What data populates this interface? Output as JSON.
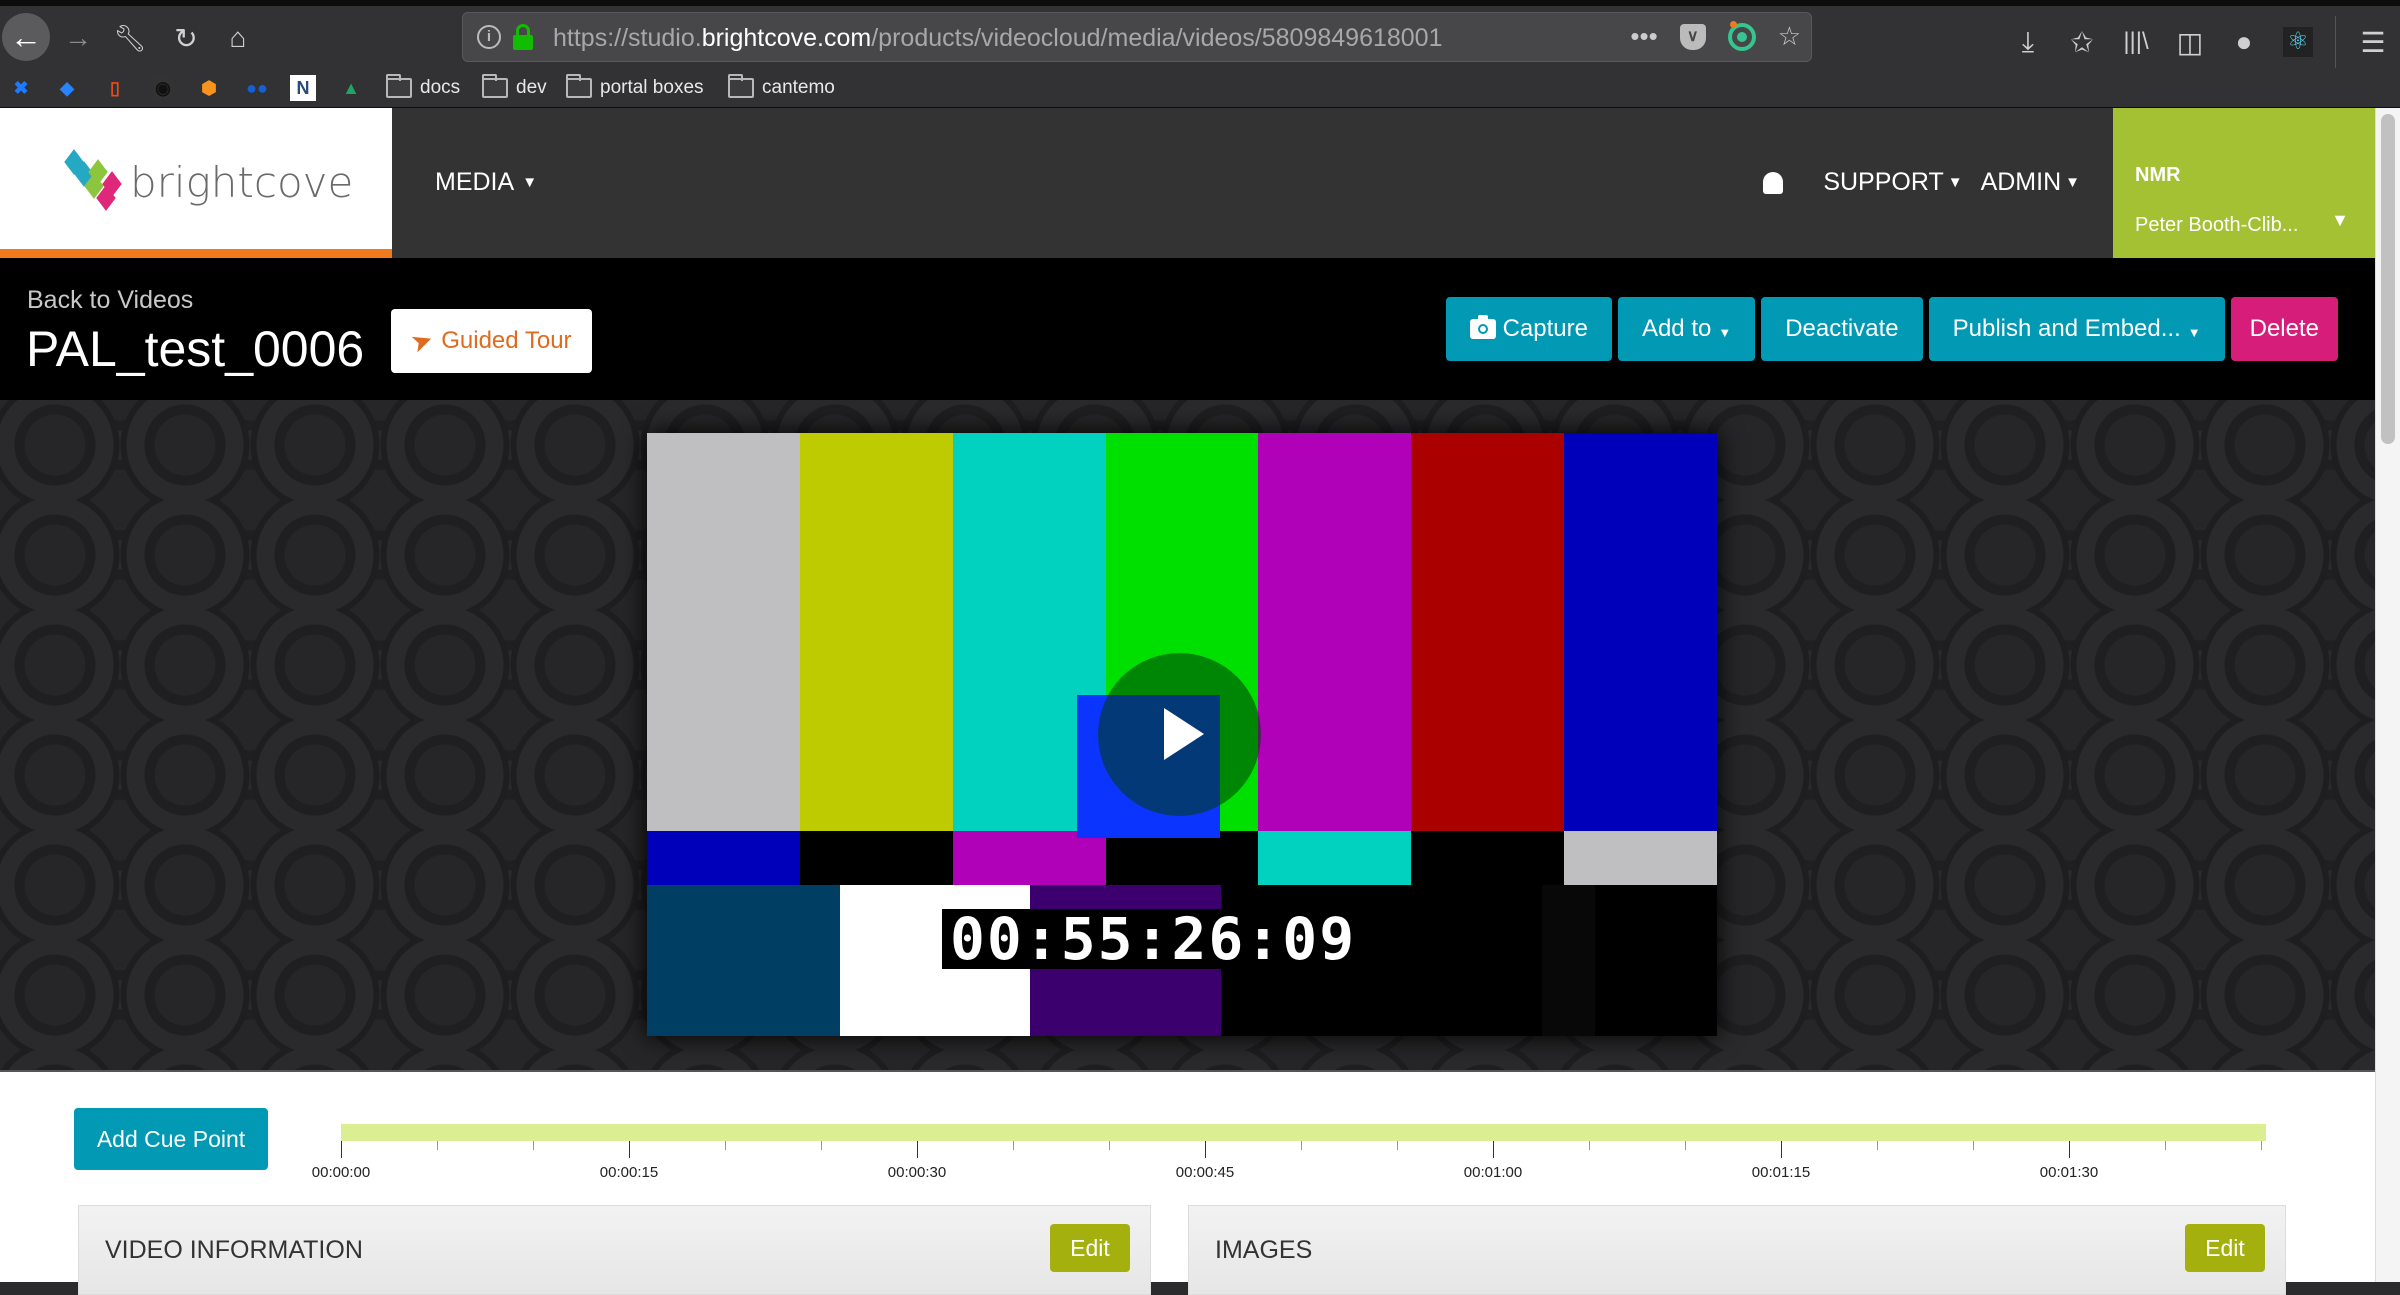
{
  "browser": {
    "url_prefix": "https://studio.",
    "url_domain": "brightcove.com",
    "url_path": "/products/videocloud/media/videos/5809849618001",
    "bookmarks": [
      {
        "icon": "confluence-icon"
      },
      {
        "icon": "jira-icon"
      },
      {
        "icon": "office-icon"
      },
      {
        "icon": "github-icon"
      },
      {
        "icon": "box-icon"
      },
      {
        "icon": "people-icon"
      },
      {
        "icon": "n-icon"
      },
      {
        "icon": "google-drive-icon"
      }
    ],
    "folders": [
      "docs",
      "dev",
      "portal boxes",
      "cantemo"
    ]
  },
  "header": {
    "brand": "brightcove",
    "nav_media": "MEDIA",
    "nav_support": "SUPPORT",
    "nav_admin": "ADMIN",
    "user_org": "NMR",
    "user_name": "Peter Booth-Clib..."
  },
  "titlebar": {
    "back_link": "Back to Videos",
    "video_title": "PAL_test_0006",
    "guided_tour": "Guided Tour",
    "actions": {
      "capture": "Capture",
      "add_to": "Add to",
      "deactivate": "Deactivate",
      "publish": "Publish and Embed...",
      "delete": "Delete"
    }
  },
  "player": {
    "timecode": "00:55:26:09",
    "colors": {
      "top": [
        "#bfbec0",
        "#bdcb00",
        "#00d2bf",
        "#00e000",
        "#b000b8",
        "#aa0000",
        "#0000bb"
      ],
      "middle": [
        "#0000bb",
        "#000000",
        "#b000b8",
        "#000000",
        "#00d2bf",
        "#000000",
        "#bfbec0"
      ],
      "bottom": [
        "#003e63",
        "#ffffff",
        "#3b006e",
        "#000000",
        "#080808",
        "#000000"
      ]
    }
  },
  "cue_points": {
    "add_button": "Add Cue Point",
    "tick_labels": [
      "00:00:00",
      "00:00:15",
      "00:00:30",
      "00:00:45",
      "00:01:00",
      "00:01:15",
      "00:01:30"
    ]
  },
  "panels": {
    "video_info": "VIDEO INFORMATION",
    "images": "IMAGES",
    "edit": "Edit"
  }
}
